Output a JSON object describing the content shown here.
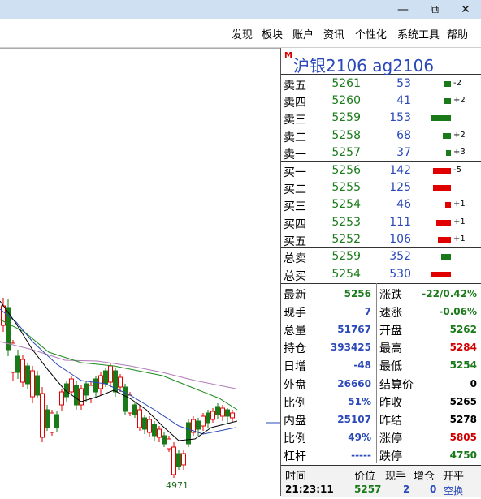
{
  "window": {
    "minimize": "—",
    "restore": "⧉",
    "close": "✕"
  },
  "menu": [
    "发现",
    "板块",
    "账户",
    "资讯",
    "个性化",
    "系统工具",
    "帮助"
  ],
  "chart": {
    "low_label": "4971"
  },
  "quote": {
    "badge": "M",
    "title": "沪银2106  ag2106",
    "sells": [
      {
        "label": "卖五",
        "price": "5261",
        "vol": "53",
        "chg": "-2",
        "bar": 8
      },
      {
        "label": "卖四",
        "price": "5260",
        "vol": "41",
        "chg": "+2",
        "bar": 8
      },
      {
        "label": "卖三",
        "price": "5259",
        "vol": "153",
        "chg": "",
        "bar": 24
      },
      {
        "label": "卖二",
        "price": "5258",
        "vol": "68",
        "chg": "+2",
        "bar": 10
      },
      {
        "label": "卖一",
        "price": "5257",
        "vol": "37",
        "chg": "+3",
        "bar": 6
      }
    ],
    "buys": [
      {
        "label": "买一",
        "price": "5256",
        "vol": "142",
        "chg": "-5",
        "bar": 22
      },
      {
        "label": "买二",
        "price": "5255",
        "vol": "125",
        "chg": "",
        "bar": 22
      },
      {
        "label": "买三",
        "price": "5254",
        "vol": "46",
        "chg": "+1",
        "bar": 7
      },
      {
        "label": "买四",
        "price": "5253",
        "vol": "111",
        "chg": "+1",
        "bar": 18
      },
      {
        "label": "买五",
        "price": "5252",
        "vol": "106",
        "chg": "+1",
        "bar": 16
      }
    ],
    "totals": [
      {
        "label": "总卖",
        "price": "5259",
        "vol": "352",
        "bar": 12
      },
      {
        "label": "总买",
        "price": "5254",
        "vol": "530",
        "bar": 24
      }
    ],
    "stats": [
      {
        "k": "最新",
        "v": "5256",
        "c": "#1a7a1a"
      },
      {
        "k": "涨跌",
        "v": "-22/0.42%",
        "c": "#1a7a1a"
      },
      {
        "k": "现手",
        "v": "7",
        "c": "#2a48b8"
      },
      {
        "k": "速涨",
        "v": "-0.06%",
        "c": "#1a7a1a"
      },
      {
        "k": "总量",
        "v": "51767",
        "c": "#2a48b8"
      },
      {
        "k": "开盘",
        "v": "5262",
        "c": "#1a7a1a"
      },
      {
        "k": "持仓",
        "v": "393425",
        "c": "#2a48b8"
      },
      {
        "k": "最高",
        "v": "5284",
        "c": "#d00000"
      },
      {
        "k": "日增",
        "v": "-48",
        "c": "#2a48b8"
      },
      {
        "k": "最低",
        "v": "5254",
        "c": "#1a7a1a"
      },
      {
        "k": "外盘",
        "v": "26660",
        "c": "#2a48b8"
      },
      {
        "k": "结算价",
        "v": "0",
        "c": "#000000"
      },
      {
        "k": "比例",
        "v": "51%",
        "c": "#2a48b8"
      },
      {
        "k": "昨收",
        "v": "5265",
        "c": "#000000"
      },
      {
        "k": "内盘",
        "v": "25107",
        "c": "#2a48b8"
      },
      {
        "k": "昨结",
        "v": "5278",
        "c": "#000000"
      },
      {
        "k": "比例",
        "v": "49%",
        "c": "#2a48b8"
      },
      {
        "k": "涨停",
        "v": "5805",
        "c": "#d00000"
      },
      {
        "k": "杠杆",
        "v": "-----",
        "c": "#2a48b8"
      },
      {
        "k": "跌停",
        "v": "4750",
        "c": "#1a7a1a"
      }
    ],
    "ticks": {
      "headers": [
        "时间",
        "价位",
        "现手",
        "增仓",
        "开平"
      ],
      "row": [
        "21:23:11",
        "5257",
        "2",
        "0",
        "空换"
      ]
    }
  }
}
